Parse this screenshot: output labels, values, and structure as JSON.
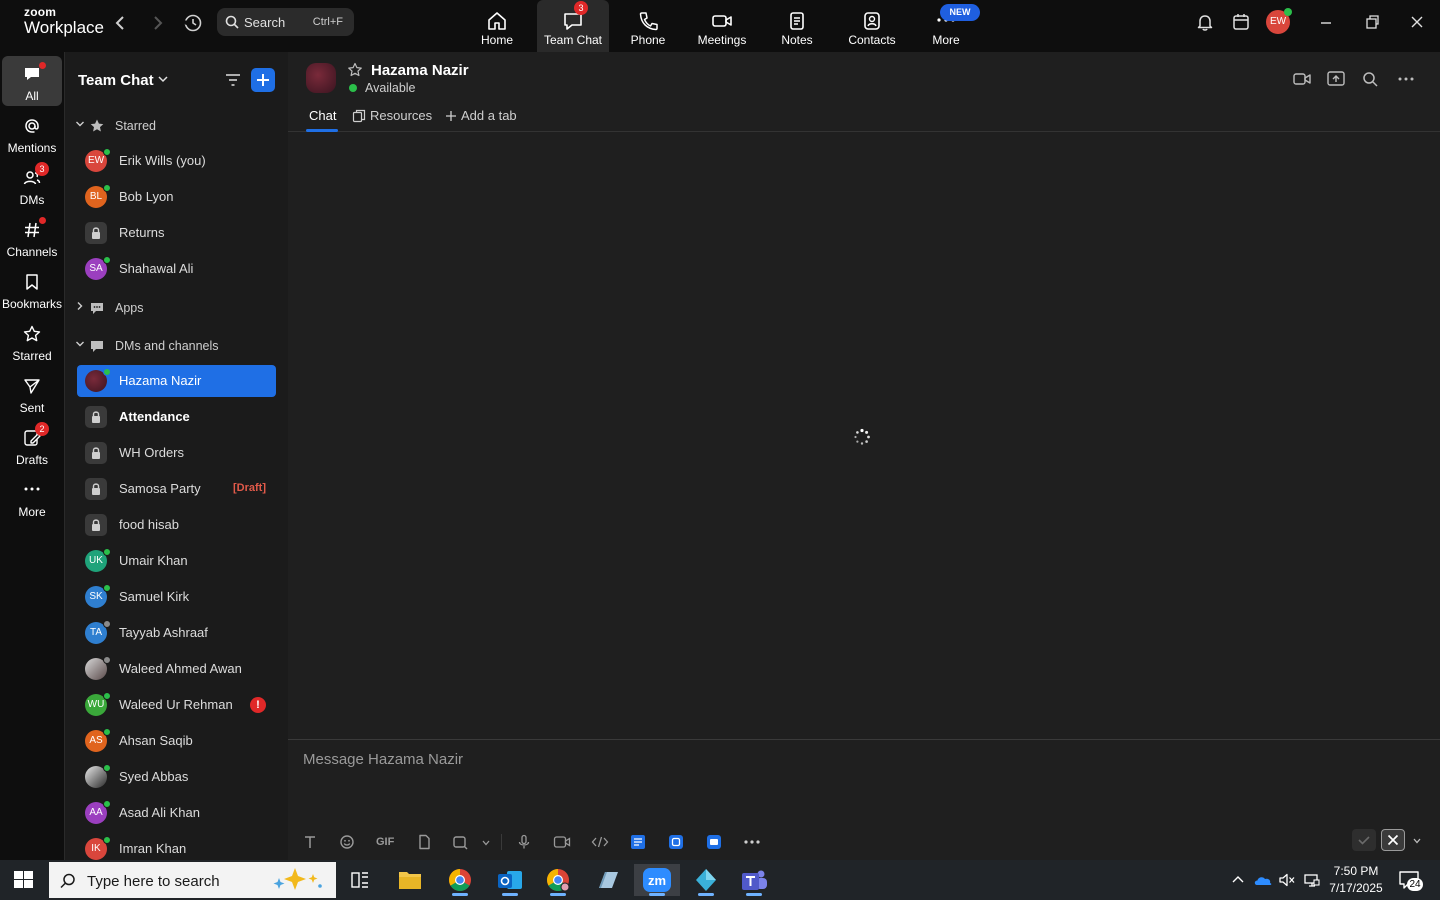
{
  "app": {
    "logo_line1": "zoom",
    "logo_line2": "Workplace",
    "search_label": "Search",
    "search_shortcut": "Ctrl+F",
    "new_badge": "NEW",
    "user_initials": "EW"
  },
  "nav_tabs": [
    {
      "label": "Home",
      "icon": "home-icon"
    },
    {
      "label": "Team Chat",
      "icon": "chat-icon",
      "badge": "3",
      "active": true
    },
    {
      "label": "Phone",
      "icon": "phone-icon"
    },
    {
      "label": "Meetings",
      "icon": "video-icon"
    },
    {
      "label": "Notes",
      "icon": "notes-icon"
    },
    {
      "label": "Contacts",
      "icon": "contacts-icon"
    },
    {
      "label": "More",
      "icon": "more-icon"
    }
  ],
  "rail": [
    {
      "label": "All",
      "active": true
    },
    {
      "label": "Mentions"
    },
    {
      "label": "DMs",
      "badge": "3"
    },
    {
      "label": "Channels"
    },
    {
      "label": "Bookmarks"
    },
    {
      "label": "Starred"
    },
    {
      "label": "Sent"
    },
    {
      "label": "Drafts",
      "badge": "2"
    },
    {
      "label": "More"
    }
  ],
  "sidebar": {
    "title": "Team Chat",
    "sections": {
      "starred": "Starred",
      "apps": "Apps",
      "dms": "DMs and channels"
    },
    "starred_items": [
      {
        "name": "Erik Wills (you)",
        "initials": "EW",
        "color": "#d9463c",
        "presence": "online"
      },
      {
        "name": "Bob Lyon",
        "initials": "BL",
        "color": "#e0641e",
        "presence": "online"
      },
      {
        "name": "Returns",
        "type": "channel"
      },
      {
        "name": "Shahawal Ali",
        "initials": "SA",
        "color": "#9b3fbf",
        "presence": "online"
      }
    ],
    "dm_items": [
      {
        "name": "Hazama Nazir",
        "type": "photo",
        "presence": "online",
        "selected": true
      },
      {
        "name": "Attendance",
        "type": "channel",
        "bold": true
      },
      {
        "name": "WH Orders",
        "type": "channel"
      },
      {
        "name": "Samosa Party",
        "type": "channel",
        "draft": "[Draft]"
      },
      {
        "name": "food hisab",
        "type": "channel"
      },
      {
        "name": "Umair Khan",
        "initials": "UK",
        "color": "#1fa37a",
        "presence": "online"
      },
      {
        "name": "Samuel Kirk",
        "initials": "SK",
        "color": "#2f7fd0",
        "presence": "online"
      },
      {
        "name": "Tayyab Ashraaf",
        "initials": "TA",
        "color": "#2f7fd0",
        "presence": "away"
      },
      {
        "name": "Waleed Ahmed Awan",
        "type": "photo",
        "presence": "away"
      },
      {
        "name": "Waleed Ur Rehman",
        "initials": "WU",
        "color": "#3aa83a",
        "presence": "online",
        "alert": "!"
      },
      {
        "name": "Ahsan Saqib",
        "initials": "AS",
        "color": "#e0641e",
        "presence": "online"
      },
      {
        "name": "Syed Abbas",
        "type": "photo",
        "presence": "online"
      },
      {
        "name": "Asad Ali Khan",
        "initials": "AA",
        "color": "#9b3fbf",
        "presence": "online"
      },
      {
        "name": "Imran Khan",
        "initials": "IK",
        "color": "#d9463c",
        "presence": "online"
      }
    ]
  },
  "chat": {
    "name": "Hazama Nazir",
    "status": "Available",
    "tabs": [
      "Chat",
      "Resources",
      "Add a tab"
    ],
    "composer_placeholder": "Message Hazama Nazir",
    "gif_label": "GIF"
  },
  "taskbar": {
    "search_placeholder": "Type here to search",
    "time": "7:50 PM",
    "date": "7/17/2025",
    "notif_count": "24"
  },
  "colors": {
    "accent": "#1f6fe5",
    "badge": "#e02828",
    "online": "#2bbf4a",
    "background": "#1f1f1f"
  }
}
